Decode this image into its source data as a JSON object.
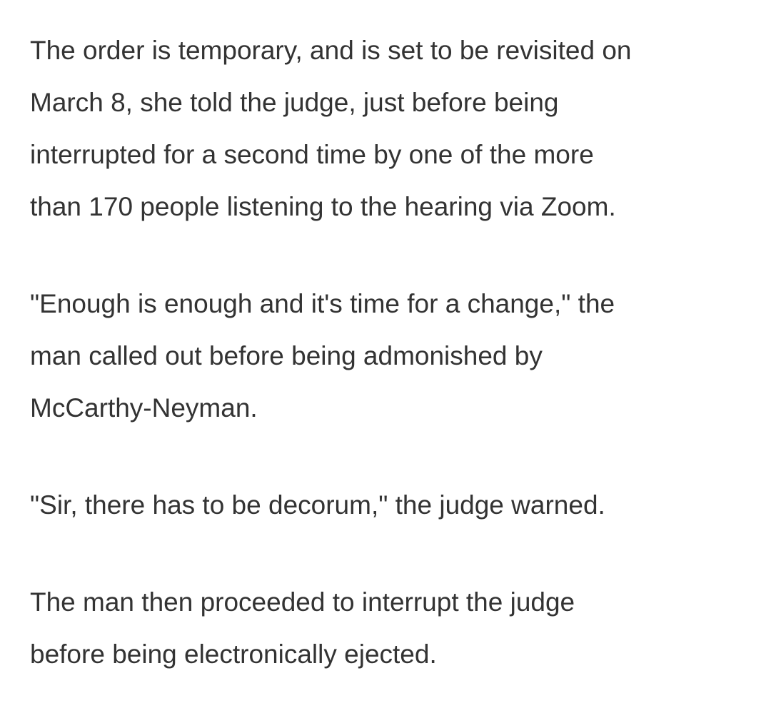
{
  "article": {
    "paragraphs": [
      {
        "lines": [
          "The order is temporary, and is set to be revisited on",
          "March 8, she told the judge, just before being",
          "interrupted for a second time by one of the more",
          "than 170 people listening to the hearing via Zoom."
        ]
      },
      {
        "lines": [
          "\"Enough is enough and it's time for a change,\" the",
          "man called out before being admonished by",
          "McCarthy-Neyman."
        ]
      },
      {
        "lines": [
          "\"Sir, there has to be decorum,\" the judge warned."
        ]
      },
      {
        "lines": [
          "The man then proceeded to interrupt the judge",
          "before being electronically ejected."
        ]
      }
    ]
  }
}
